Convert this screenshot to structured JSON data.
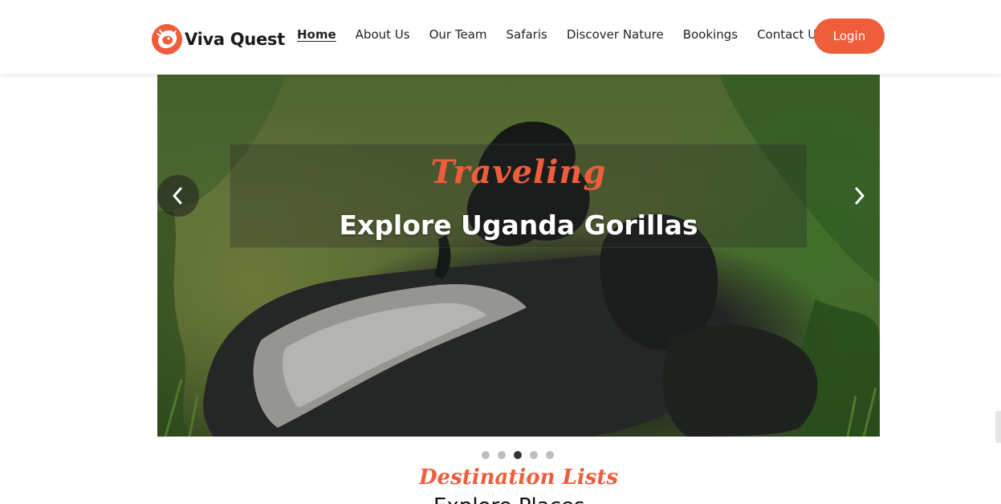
{
  "brand": {
    "name": "Viva Quest",
    "logo_icon": "lion-head-icon",
    "accent_color": "#f05d3b"
  },
  "nav": {
    "items": [
      {
        "label": "Home",
        "active": true
      },
      {
        "label": "About Us",
        "active": false
      },
      {
        "label": "Our Team",
        "active": false
      },
      {
        "label": "Safaris",
        "active": false
      },
      {
        "label": "Discover Nature",
        "active": false
      },
      {
        "label": "Bookings",
        "active": false
      },
      {
        "label": "Contact Us",
        "active": false
      }
    ],
    "login_label": "Login"
  },
  "hero": {
    "script_text": "Traveling",
    "title": "Explore Uganda Gorillas",
    "image_subject": "gorillas",
    "prev_icon": "chevron-left-icon",
    "next_icon": "chevron-right-icon",
    "slide_count": 5,
    "active_slide": 3
  },
  "section": {
    "title": "Destination Lists",
    "next_heading_partial": "Explore Places"
  }
}
